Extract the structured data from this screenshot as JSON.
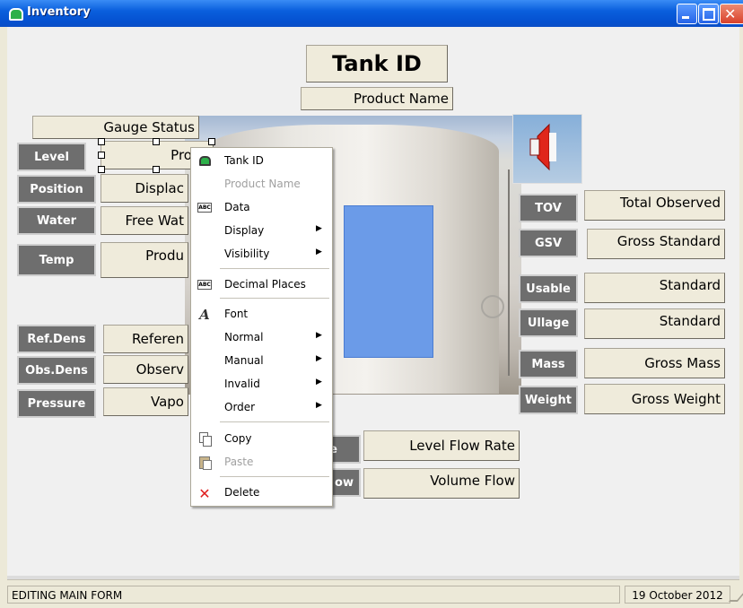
{
  "window": {
    "title": "Inventory"
  },
  "header": {
    "tank_id": "Tank ID",
    "product_name": "Product Name",
    "gauge_status": "Gauge Status"
  },
  "left_fields": [
    {
      "label": "Level",
      "value": "Produ"
    },
    {
      "label": "Position",
      "value": "Displac"
    },
    {
      "label": "Water",
      "value": "Free Wat"
    },
    {
      "label": "Temp",
      "value": "Produ"
    }
  ],
  "left_density": [
    {
      "label": "Ref.Dens",
      "value": "Referen"
    },
    {
      "label": "Obs.Dens",
      "value": "Observ"
    },
    {
      "label": "Pressure",
      "value": "Vapo"
    }
  ],
  "right_fields": [
    {
      "label": "TOV",
      "value": "Total Observed"
    },
    {
      "label": "GSV",
      "value": "Gross Standard"
    },
    {
      "label": "Usable",
      "value": "Standard"
    },
    {
      "label": "Ullage",
      "value": "Standard"
    },
    {
      "label": "Mass",
      "value": "Gross Mass"
    },
    {
      "label": "Weight",
      "value": "Gross Weight"
    }
  ],
  "flow": [
    {
      "label": "e",
      "value": "Level Flow Rate"
    },
    {
      "label": "ow",
      "value": "Volume Flow"
    }
  ],
  "context_menu": {
    "items": [
      {
        "label": "Tank ID",
        "icon": "tank-icon",
        "disabled": false,
        "submenu": false
      },
      {
        "label": "Product Name",
        "icon": "",
        "disabled": true,
        "submenu": false
      },
      {
        "label": "Data",
        "icon": "abc-icon",
        "disabled": false,
        "submenu": false
      },
      {
        "label": "Display",
        "icon": "",
        "disabled": false,
        "submenu": true
      },
      {
        "label": "Visibility",
        "icon": "",
        "disabled": false,
        "submenu": true
      },
      {
        "label": "Decimal Places",
        "icon": "abc-icon",
        "disabled": false,
        "submenu": false
      },
      {
        "label": "Font",
        "icon": "font-icon",
        "disabled": false,
        "submenu": false
      },
      {
        "label": "Normal",
        "icon": "",
        "disabled": false,
        "submenu": true
      },
      {
        "label": "Manual",
        "icon": "",
        "disabled": false,
        "submenu": true
      },
      {
        "label": "Invalid",
        "icon": "",
        "disabled": false,
        "submenu": true
      },
      {
        "label": "Order",
        "icon": "",
        "disabled": false,
        "submenu": true
      },
      {
        "label": "Copy",
        "icon": "copy-icon",
        "disabled": false,
        "submenu": false
      },
      {
        "label": "Paste",
        "icon": "paste-icon",
        "disabled": true,
        "submenu": false
      },
      {
        "label": "Delete",
        "icon": "delete-icon",
        "disabled": false,
        "submenu": false
      }
    ]
  },
  "statusbar": {
    "mode": "EDITING MAIN FORM",
    "date": "19 October 2012"
  },
  "colors": {
    "title_bar": "#0A5FDD",
    "label_bg": "#6E6E6E",
    "field_bg": "#EFEBDB",
    "tank_fill": "#6B9BE8",
    "speaker": "#E0261B"
  }
}
